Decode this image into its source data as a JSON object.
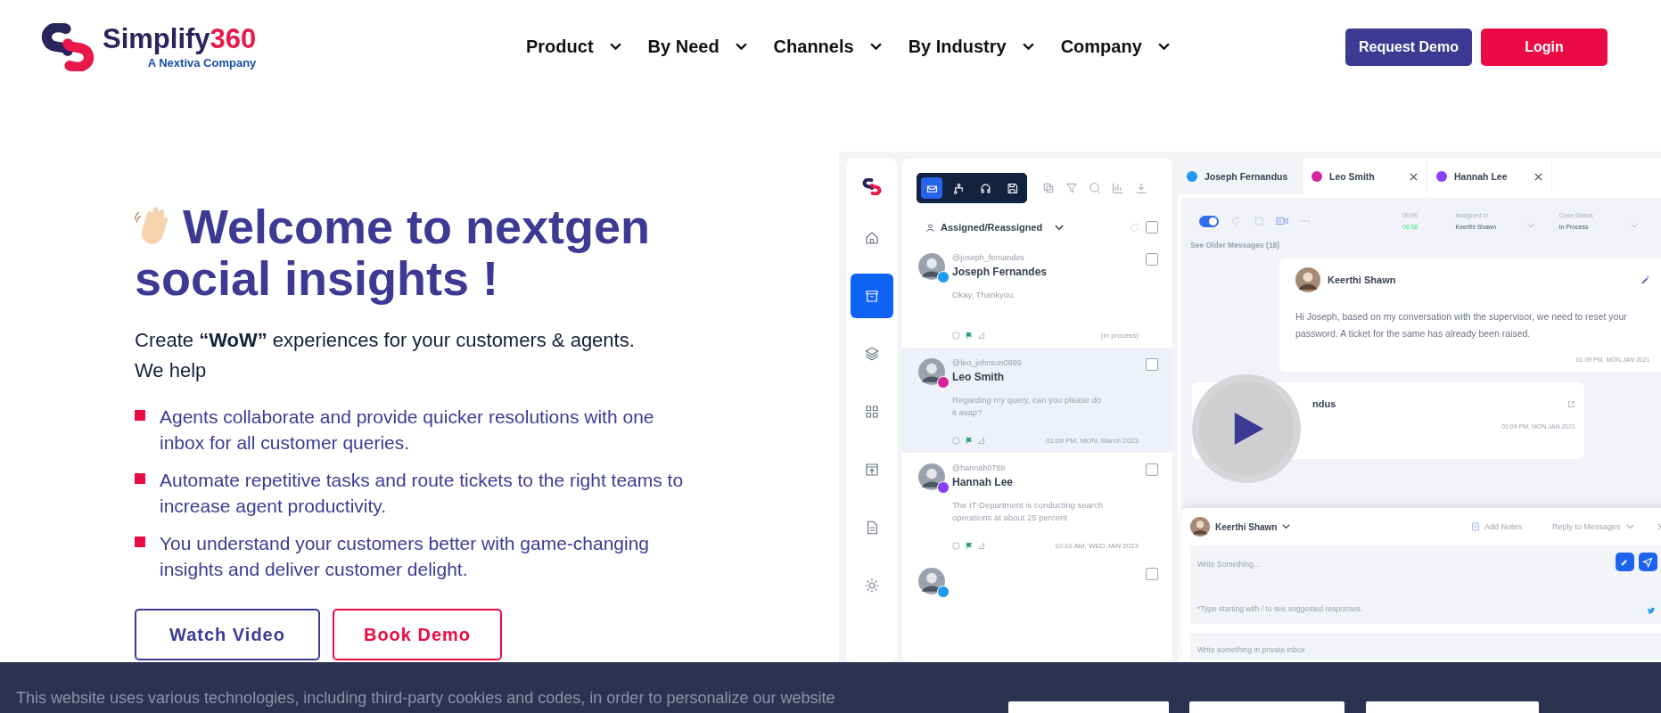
{
  "brand": {
    "name": "Simplify",
    "number": "360",
    "tagline": "A Nextiva Company"
  },
  "nav": [
    {
      "label": "Product"
    },
    {
      "label": "By Need"
    },
    {
      "label": "Channels"
    },
    {
      "label": "By Industry"
    },
    {
      "label": "Company"
    }
  ],
  "header_buttons": [
    {
      "label": "Request Demo",
      "kind": "primary"
    },
    {
      "label": "Login",
      "kind": "accent"
    }
  ],
  "hero": {
    "title_line_1": "Welcome to nextgen",
    "title_line_2": "social insights !",
    "intro": "Create **“WoW”** experiences for your customers & agents.",
    "intro_2": "We help",
    "bullets": [
      "Agents collaborate and provide quicker resolutions with one inbox for all customer queries.",
      "Automate repetitive tasks and route tickets to the right teams to increase agent productivity.",
      "You understand your customers better with game-changing insights and deliver customer delight."
    ],
    "buttons": [
      {
        "label": "Watch Video",
        "kind": "outline-primary"
      },
      {
        "label": "Book Demo",
        "kind": "outline-accent"
      }
    ]
  },
  "app_preview": {
    "sidebar_items": [
      {
        "selected": false
      },
      {
        "selected": true
      },
      {
        "selected": false
      },
      {
        "selected": false
      },
      {
        "selected": false
      },
      {
        "selected": false
      },
      {
        "selected": false
      }
    ],
    "mode_tabs": [
      {
        "selected": true
      },
      {
        "selected": false
      },
      {
        "selected": false
      },
      {
        "selected": false
      }
    ],
    "filter": "Assigned/Reassigned",
    "conversations": [
      {
        "handle": "@joseph_fernandes",
        "name": "Joseph Fernandes",
        "message": "Okay, Thankyou.",
        "meta": "(In process)",
        "color": "#1d9bf0",
        "selected": false,
        "checked": false
      },
      {
        "handle": "@leo_johnson0899",
        "name": "Leo Smith",
        "message": "Regarding my query, can you please do it asap?",
        "meta": "01:09 PM, MON, March 2023",
        "color": "#d6249f",
        "selected": true,
        "checked": false
      },
      {
        "handle": "@hannah0789",
        "name": "Hannah Lee",
        "message": "The IT-Department is conducting search operations at about 25 percent",
        "meta": "10:10 AM, WED JAN 2023",
        "color": "#8a3ffc",
        "selected": false,
        "checked": false
      },
      {
        "color": "#1d9bf0",
        "selected": false,
        "checked": false
      }
    ],
    "select_all_checked": false,
    "tabs": [
      {
        "label": "Joseph Fernandus",
        "color": "#1d9bf0",
        "selected": true
      },
      {
        "label": "Leo Smith",
        "color": "#d6249f",
        "selected": false
      },
      {
        "label": "Hannah Lee",
        "color": "#8a3ffc",
        "selected": false
      }
    ],
    "toggle_on": true,
    "timer": {
      "label": "00:00",
      "value": "06:58"
    },
    "assigned": {
      "label": "Assigned to",
      "value": "Keerthi Shawn"
    },
    "case_status": {
      "label": "Case Status",
      "value": "In Process"
    },
    "older_messages": "See Older Messages (18)",
    "message": {
      "author": "Keerthi Shawn",
      "text": "Hi Joseph, based on my conversation with the supervisor, we need to reset your password. A ticket for the same has already been raised.",
      "time": "01:09 PM, MON,JAN 2021"
    },
    "message_2": {
      "author": "ndus",
      "time": "01:09 PM, MON,JAN 2021"
    },
    "reply": {
      "author": "Keerthi Shawn",
      "notes": "Add Notes",
      "mode": "Reply to Messages",
      "placeholder": "Write Something...",
      "hint": "*Type starting with / to see suggested responses.",
      "private_placeholder": "Write something in private inbox"
    }
  },
  "cookie": {
    "text": "This website uses various technologies, including third-party cookies and codes, in order to personalize our website"
  }
}
